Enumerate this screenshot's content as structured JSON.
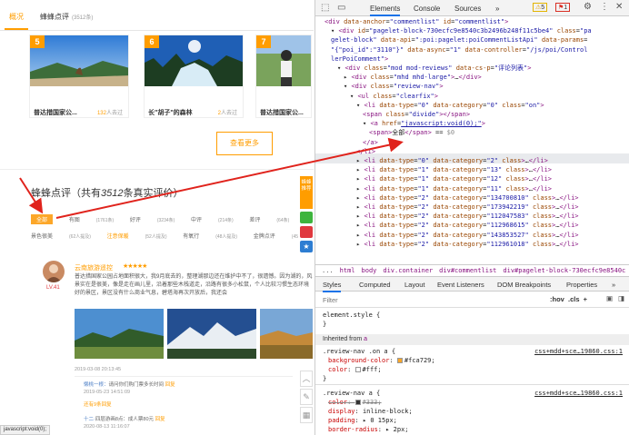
{
  "left": {
    "nav": {
      "overview": "概况",
      "reviews": "蜂蜂点评",
      "reviews_count": "(3512条)"
    },
    "cards": [
      {
        "num": "5",
        "name": "普达措国家公...",
        "count": "132",
        "count_suffix": "人去过"
      },
      {
        "num": "6",
        "name": "长\"胡子\"的森林",
        "count": "2",
        "count_suffix": "人去过"
      },
      {
        "num": "7",
        "name": "普达措国家公...",
        "count": "1",
        "count_suffix": "人去过"
      }
    ],
    "see_more": "查看更多",
    "review_title_pre": "蜂蜂点评（共有",
    "review_title_num": "3512",
    "review_title_post": "条真实评价）",
    "filters_row1": [
      {
        "label": "全部",
        "count": "",
        "active": true
      },
      {
        "label": "有图",
        "count": "(1761条)"
      },
      {
        "label": "好评",
        "count": "(3234条)"
      },
      {
        "label": "中评",
        "count": "(214条)"
      },
      {
        "label": "差评",
        "count": "(64条)"
      },
      {
        "label": "值",
        "count": ""
      }
    ],
    "filters_row2": [
      {
        "label": "景色很美",
        "count": "(62人提及)"
      },
      {
        "label": "注意保暖",
        "count": "(52人提及)",
        "orange": true
      },
      {
        "label": "有氧行",
        "count": "(48人提及)"
      },
      {
        "label": "金牌点评",
        "count": "(45"
      }
    ],
    "reviewer": {
      "name": "云南旅游遥控",
      "level": "LV.41",
      "stars": "★★★★★"
    },
    "review_text": "普达措国家公园占地面积很大，我9月底去的，整理湖那边还在维护中不了，很遗憾。因为湖的，风景实在是很美，像是走在画儿里，沿着那些木栈道走，沿路有很多小松鼠，个人比较习惯生态环境好的景区，景区没有什么商业气息，碧塔海再次开放后，我还会",
    "review_date": "2019-03-08 20:13:45",
    "comments": [
      {
        "user": "懒桃一根：",
        "text": "请问你们购门票多长时间",
        "reply": "回复",
        "time": "2019-05-23 14:51:09"
      },
      {
        "user": "还有",
        "text": "9条回复",
        "reply": "",
        "time": ""
      },
      {
        "user": "十二·",
        "text": "四层游画8点：成人票80元",
        "reply": "回复",
        "time": "2020-08-13 11:16:07"
      }
    ],
    "side_buttons": [
      "蜂蜂",
      "推荐"
    ],
    "status": "javascript:void(0);"
  },
  "devtools": {
    "tabs": [
      "Elements",
      "Console",
      "Sources",
      "»"
    ],
    "warn_count": "5",
    "err_count": "1",
    "dom_lines": [
      {
        "indent": 0,
        "html": "<span class='tg'>&lt;div</span> <span class='at'>data-anchor</span>=<span class='av'>\"commentlist\"</span> <span class='at'>id</span>=<span class='av'>\"commentlist\"</span><span class='tg'>&gt;</span>"
      },
      {
        "indent": 1,
        "html": "▾ <span class='tg'>&lt;div</span> <span class='at'>id</span>=<span class='av'>\"pagelet-block-730ecfc9e8540c3b2496b248f11c5be4\"</span> <span class='at'>class</span>=<span class='av'>\"pa</span>"
      },
      {
        "indent": 1,
        "html": "<span class='av'>gelet-block\"</span> <span class='at'>data-api</span>=<span class='av'>\":poi:pagelet:poiCommentListApi\"</span> <span class='at'>data-params</span>="
      },
      {
        "indent": 1,
        "html": "<span class='av'>\"{\"poi_id\":\"3110\"}\"</span> <span class='at'>data-async</span>=<span class='av'>\"1\"</span> <span class='at'>data-controller</span>=<span class='av'>\"/js/poi/Control</span>"
      },
      {
        "indent": 1,
        "html": "<span class='av'>lerPoiComment\"</span><span class='tg'>&gt;</span>"
      },
      {
        "indent": 2,
        "html": "▾ <span class='tg'>&lt;div</span> <span class='at'>class</span>=<span class='av'>\"mod mod-reviews\"</span> <span class='at'>data-cs-p</span>=<span class='av'>\"评论列表\"</span><span class='tg'>&gt;</span>"
      },
      {
        "indent": 3,
        "html": "▸ <span class='tg'>&lt;div</span> <span class='at'>class</span>=<span class='av'>\"mhd mhd-large\"</span><span class='tg'>&gt;</span>…<span class='tg'>&lt;/div&gt;</span>"
      },
      {
        "indent": 3,
        "html": "▾ <span class='tg'>&lt;div</span> <span class='at'>class</span>=<span class='av'>\"review-nav\"</span><span class='tg'>&gt;</span>"
      },
      {
        "indent": 4,
        "html": "▾ <span class='tg'>&lt;ul</span> <span class='at'>class</span>=<span class='av'>\"clearfix\"</span><span class='tg'>&gt;</span>"
      },
      {
        "indent": 5,
        "html": "▾ <span class='tg'>&lt;li</span> <span class='at'>data-type</span>=<span class='av'>\"0\"</span> <span class='at'>data-category</span>=<span class='av'>\"0\"</span> <span class='at'>class</span>=<span class='av'>\"on\"</span><span class='tg'>&gt;</span>"
      },
      {
        "indent": 6,
        "html": "<span class='tg'>&lt;span</span> <span class='at'>class</span>=<span class='av'>\"divide\"</span><span class='tg'>&gt;&lt;/span&gt;</span>"
      },
      {
        "indent": 6,
        "html": "▾ <span class='tg'>&lt;a</span> <span class='at'>href</span>=<span class='lk'>\"javascript:void(0);\"</span><span class='tg'>&gt;</span>"
      },
      {
        "indent": 7,
        "html": "<span class='tg'>&lt;span&gt;</span>全部<span class='tg'>&lt;/span&gt;</span> == <span style='color:#888'>$0</span>"
      },
      {
        "indent": 6,
        "html": "<span class='tg'>&lt;/a&gt;</span>"
      },
      {
        "indent": 5,
        "html": "<span class='tg'>&lt;/li&gt;</span>"
      },
      {
        "indent": 5,
        "html": "▸ <span class='tg'>&lt;li</span> <span class='at'>data-type</span>=<span class='av'>\"0\"</span> <span class='at'>data-category</span>=<span class='av'>\"2\"</span> <span class='at'>class</span><span class='tg'>&gt;</span>…<span class='tg'>&lt;/li&gt;</span>"
      },
      {
        "indent": 5,
        "html": "▸ <span class='tg'>&lt;li</span> <span class='at'>data-type</span>=<span class='av'>\"1\"</span> <span class='at'>data-category</span>=<span class='av'>\"13\"</span> <span class='at'>class</span><span class='tg'>&gt;</span>…<span class='tg'>&lt;/li&gt;</span>"
      },
      {
        "indent": 5,
        "html": "▸ <span class='tg'>&lt;li</span> <span class='at'>data-type</span>=<span class='av'>\"1\"</span> <span class='at'>data-category</span>=<span class='av'>\"12\"</span> <span class='at'>class</span><span class='tg'>&gt;</span>…<span class='tg'>&lt;/li&gt;</span>"
      },
      {
        "indent": 5,
        "html": "▸ <span class='tg'>&lt;li</span> <span class='at'>data-type</span>=<span class='av'>\"1\"</span> <span class='at'>data-category</span>=<span class='av'>\"11\"</span> <span class='at'>class</span><span class='tg'>&gt;</span>…<span class='tg'>&lt;/li&gt;</span>"
      },
      {
        "indent": 5,
        "html": "▸ <span class='tg'>&lt;li</span> <span class='at'>data-type</span>=<span class='av'>\"2\"</span> <span class='at'>data-category</span>=<span class='av'>\"134700810\"</span> <span class='at'>class</span><span class='tg'>&gt;</span>…<span class='tg'>&lt;/li&gt;</span>"
      },
      {
        "indent": 5,
        "html": "▸ <span class='tg'>&lt;li</span> <span class='at'>data-type</span>=<span class='av'>\"2\"</span> <span class='at'>data-category</span>=<span class='av'>\"173942219\"</span> <span class='at'>class</span><span class='tg'>&gt;</span>…<span class='tg'>&lt;/li&gt;</span>"
      },
      {
        "indent": 5,
        "html": "▸ <span class='tg'>&lt;li</span> <span class='at'>data-type</span>=<span class='av'>\"2\"</span> <span class='at'>data-category</span>=<span class='av'>\"112047583\"</span> <span class='at'>class</span><span class='tg'>&gt;</span>…<span class='tg'>&lt;/li&gt;</span>"
      },
      {
        "indent": 5,
        "html": "▸ <span class='tg'>&lt;li</span> <span class='at'>data-type</span>=<span class='av'>\"2\"</span> <span class='at'>data-category</span>=<span class='av'>\"112968615\"</span> <span class='at'>class</span><span class='tg'>&gt;</span>…<span class='tg'>&lt;/li&gt;</span>"
      },
      {
        "indent": 5,
        "html": "▸ <span class='tg'>&lt;li</span> <span class='at'>data-type</span>=<span class='av'>\"2\"</span> <span class='at'>data-category</span>=<span class='av'>\"143853527\"</span> <span class='at'>class</span><span class='tg'>&gt;</span>…<span class='tg'>&lt;/li&gt;</span>"
      },
      {
        "indent": 5,
        "html": "▸ <span class='tg'>&lt;li</span> <span class='at'>data-type</span>=<span class='av'>\"2\"</span> <span class='at'>data-category</span>=<span class='av'>\"112961018\"</span> <span class='at'>class</span><span class='tg'>&gt;</span>…<span class='tg'>&lt;/li&gt;</span>"
      }
    ],
    "breadcrumb": [
      "...",
      "html",
      "body",
      "div.container",
      "div#commentlist",
      "div#pagelet-block-730ecfc9e8540c"
    ],
    "style_tabs": [
      "Styles",
      "Computed",
      "Layout",
      "Event Listeners",
      "DOM Breakpoints",
      "Properties",
      "»"
    ],
    "filter_placeholder": "Filter",
    "filter_tools": ":hov  .cls  +",
    "element_style": "element.style {",
    "close_brace": "}",
    "inherited_label": "Inherited from",
    "inherited_tag": "a",
    "rule1_selector": ".review-nav .on a {",
    "rule1_src": "css+mdd+sce…19860.css:1",
    "rule1_props": [
      {
        "name": "background-color",
        "value": "#fca729;",
        "swatch": "#fca729"
      },
      {
        "name": "color",
        "value": "#fff;",
        "swatch": "#ffffff"
      }
    ],
    "rule2_selector": ".review-nav a {",
    "rule2_src": "css+mdd+sce…19860.css:1",
    "rule2_props": [
      {
        "name": "color",
        "value": "#333;",
        "swatch": "#333333",
        "strike": true
      },
      {
        "name": "display",
        "value": "inline-block;"
      },
      {
        "name": "padding",
        "value": "▸ 0 15px;"
      },
      {
        "name": "border-radius",
        "value": "▸ 2px;"
      }
    ]
  }
}
